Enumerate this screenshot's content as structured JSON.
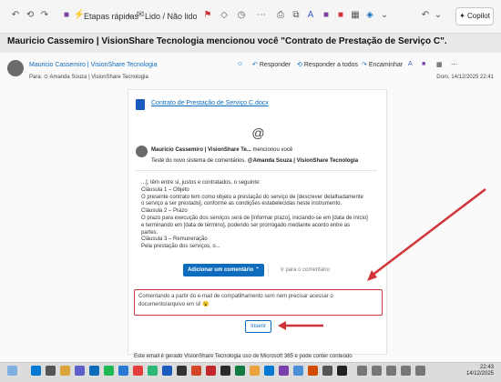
{
  "toolbar": {
    "etapas_rapidas": "Etapas rápidas",
    "lido_nao_lido": "Lido / Não lido",
    "copilot": "Copilot"
  },
  "subject": "Mauricio Cassemiro | VisionShare Tecnologia mencionou você \"Contrato de Prestação de Serviço C\".",
  "sender": {
    "name": "Mauricio Cassemiro | VisionShare Tecnologia",
    "to": "Para:  ⊙ Amanda Souza | VisionShare Tecnologia",
    "date": "Dom, 14/12/2025 22:41"
  },
  "actions": {
    "reply": "Responder",
    "reply_all": "Responder a todos",
    "forward": "Encaminhar"
  },
  "card": {
    "attachment": "Contrato de Prestação de Serviço C.docx",
    "at_symbol": "@",
    "mention_name": "Mauricio Cassemiro | VisionShare Te...",
    "mention_suffix": "mencionou você",
    "mention_text_pre": "Teste do novo sistema de comentários. ",
    "mention_text_tag": "@Amanda Souza | VisionShare Tecnologia",
    "quote": [
      "...], têm entre si, justos e contratados, o seguinte:",
      "Cláusula 1 – Objeto",
      "O presente contrato tem como objeto a prestação do serviço de [descrever detalhadamente",
      "o serviço a ser prestado], conforme as condições estabelecidas neste instrumento.",
      "Cláusula 2 – Prazo",
      "O prazo para execução dos serviços será de [informar prazo], iniciando-se em [data de início]",
      "e terminando em [data de término], podendo ser prorrogado mediante acordo entre as",
      "partes.",
      "Cláusula 3 – Remuneração",
      "Pela prestação dos serviços, o..."
    ],
    "add_comment": "Adicionar um comentário  ⌃",
    "go_to_comment": "Ir para o comentário",
    "comment_text": "Comentando a partir do e-mail de compatilhamento sem nem precisar acessar o documento/arquivo em si! 😮",
    "insert": "Inserir",
    "footer": "Este email é gerado VisionShare Tecnologia uso de Microsoft 365 e pode conter conteúdo"
  },
  "taskbar": {
    "time": "22:43",
    "date": "14/12/2025"
  },
  "colors": {
    "accent": "#0f6cbd",
    "annotation": "#d13438"
  }
}
